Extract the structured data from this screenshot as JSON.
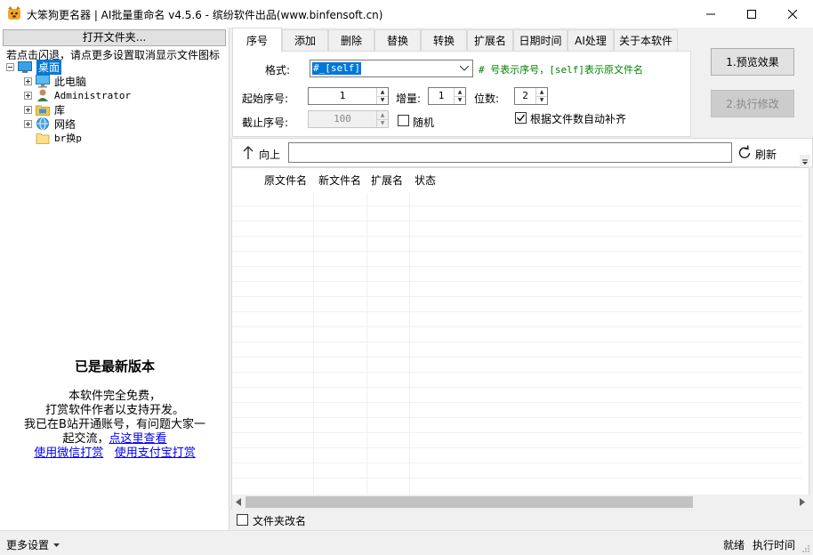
{
  "window": {
    "title": "大笨狗更名器 | AI批量重命名 v4.5.6 - 缤纷软件出品(www.binfensoft.cn)"
  },
  "left_panel": {
    "open_folder_label": "打开文件夹...",
    "hint": "若点击闪退，请点更多设置取消显示文件图标",
    "tree": [
      {
        "label": "桌面"
      },
      {
        "label": "此电脑"
      },
      {
        "label": "Administrator"
      },
      {
        "label": "库"
      },
      {
        "label": "网络"
      },
      {
        "label": "br换p"
      }
    ],
    "promo": {
      "heading": "已是最新版本",
      "line1": "本软件完全免费，",
      "line2": "打赏软件作者以支持开发。",
      "line3": "我已在B站开通账号，有问题大家一",
      "line4_prefix": "起交流，",
      "line4_link": "点这里查看",
      "wechat_link": "使用微信打赏",
      "alipay_link": "使用支付宝打赏"
    }
  },
  "tabs": [
    "序号",
    "添加",
    "删除",
    "替换",
    "转换",
    "扩展名",
    "日期时间",
    "AI处理",
    "关于本软件"
  ],
  "serial": {
    "format_label": "格式:",
    "format_value": "#_[self]",
    "format_hint": "# 号表示序号，[self]表示原文件名",
    "start_label": "起始序号:",
    "start_value": "1",
    "increment_label": "增量:",
    "increment_value": "1",
    "digits_label": "位数:",
    "digits_value": "2",
    "end_label": "截止序号:",
    "end_value": "100",
    "random_label": "随机",
    "autopad_label": "根据文件数自动补齐"
  },
  "actions": {
    "preview_label": "1.预览效果",
    "execute_label": "2.执行修改"
  },
  "pathbar": {
    "up_label": "向上",
    "path_value": "",
    "refresh_label": "刷新"
  },
  "list": {
    "columns": [
      "原文件名",
      "新文件名",
      "扩展名",
      "状态"
    ]
  },
  "bottom": {
    "rename_folders_label": "文件夹改名",
    "more_settings_label": "更多设置",
    "status_ready": "就绪",
    "status_exec_time": "执行时间"
  },
  "colors": {
    "selection": "#0078d7",
    "hint_green": "#008000",
    "link_blue": "#0000ee"
  }
}
